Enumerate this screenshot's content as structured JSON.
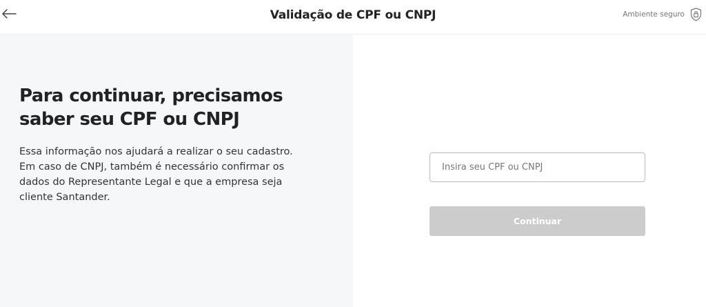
{
  "header": {
    "back_icon": "arrow-left-icon",
    "title": "Validação de CPF ou CNPJ",
    "secure_label": "Ambiente seguro",
    "secure_icon": "lock-shield-icon"
  },
  "intro": {
    "title": "Para continuar, precisamos saber seu CPF ou CNPJ",
    "body": "Essa informação nos ajudará a realizar o seu cadastro.\nEm caso de CNPJ, também é necessário confirmar os dados do Representante Legal e que a empresa seja cliente Santander."
  },
  "form": {
    "document_input": {
      "value": "",
      "placeholder": "Insira seu CPF ou CNPJ"
    },
    "continue_label": "Continuar",
    "continue_disabled": true
  },
  "colors": {
    "left_panel_bg": "#f6f7f9",
    "input_border": "#9fc4d6",
    "disabled_button_bg": "#cccccc"
  }
}
